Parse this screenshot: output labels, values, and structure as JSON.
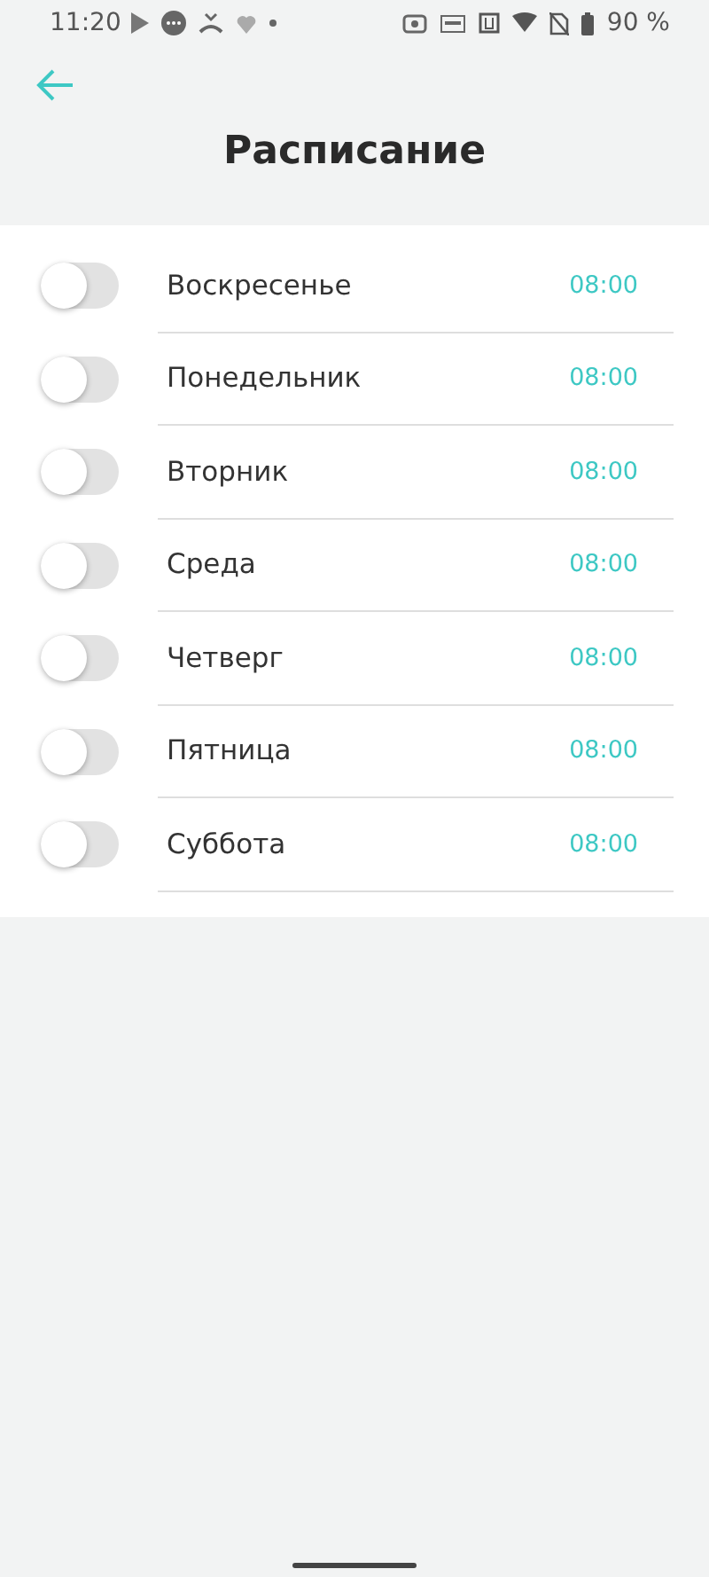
{
  "status_bar": {
    "time": "11:20",
    "battery": "90 %"
  },
  "header": {
    "title": "Расписание"
  },
  "days": [
    {
      "name": "Воскресенье",
      "time": "08:00",
      "on": false
    },
    {
      "name": "Понедельник",
      "time": "08:00",
      "on": false
    },
    {
      "name": "Вторник",
      "time": "08:00",
      "on": false
    },
    {
      "name": "Среда",
      "time": "08:00",
      "on": false
    },
    {
      "name": "Четверг",
      "time": "08:00",
      "on": false
    },
    {
      "name": "Пятница",
      "time": "08:00",
      "on": false
    },
    {
      "name": "Суббота",
      "time": "08:00",
      "on": false
    }
  ]
}
